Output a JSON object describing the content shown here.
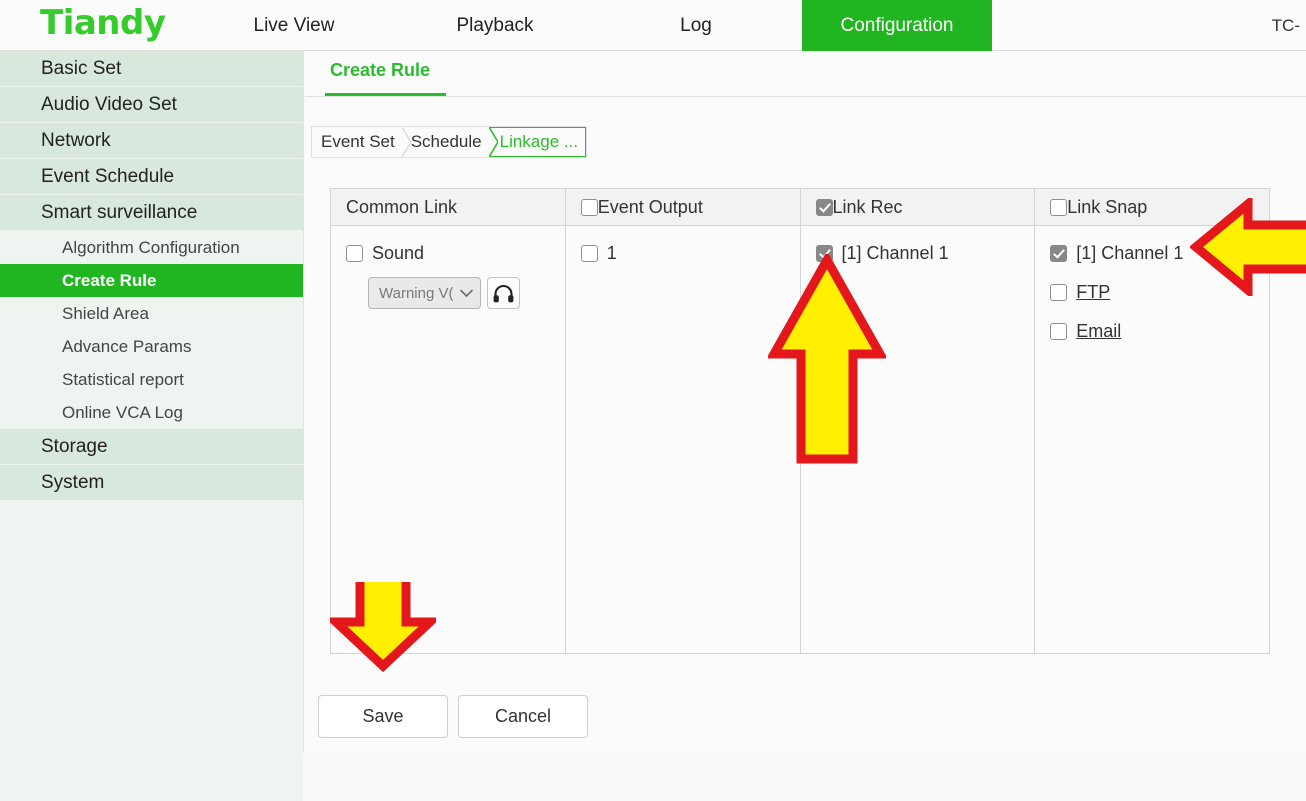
{
  "header": {
    "brand": "Tiandy",
    "nav": [
      {
        "id": "live-view",
        "label": "Live View",
        "active": false
      },
      {
        "id": "playback",
        "label": "Playback",
        "active": false
      },
      {
        "id": "log",
        "label": "Log",
        "active": false
      },
      {
        "id": "configuration",
        "label": "Configuration",
        "active": true
      }
    ],
    "device_model": "TC-",
    "active_color": "#22b522",
    "brand_color": "#35cc2c"
  },
  "sidebar": {
    "items": [
      {
        "label": "Basic Set",
        "level": "group",
        "active": false
      },
      {
        "label": "Audio Video Set",
        "level": "group",
        "active": false
      },
      {
        "label": "Network",
        "level": "group",
        "active": false
      },
      {
        "label": "Event Schedule",
        "level": "group",
        "active": false
      },
      {
        "label": "Smart surveillance",
        "level": "group",
        "active": false
      },
      {
        "label": "Algorithm Configuration",
        "level": "sub",
        "active": false
      },
      {
        "label": "Create Rule",
        "level": "sub",
        "active": true
      },
      {
        "label": "Shield Area",
        "level": "sub",
        "active": false
      },
      {
        "label": "Advance Params",
        "level": "sub",
        "active": false
      },
      {
        "label": "Statistical report",
        "level": "sub",
        "active": false
      },
      {
        "label": "Online VCA Log",
        "level": "sub",
        "active": false
      },
      {
        "label": "Storage",
        "level": "group",
        "active": false
      },
      {
        "label": "System",
        "level": "group",
        "active": false
      }
    ]
  },
  "content": {
    "tab_label": "Create Rule",
    "steps": [
      {
        "label": "Event Set",
        "active": false
      },
      {
        "label": "Schedule",
        "active": false
      },
      {
        "label": "Linkage ...",
        "active": true
      }
    ],
    "columns": [
      {
        "header": "Common Link",
        "header_has_checkbox": false,
        "header_checked": false,
        "rows": [
          {
            "label": "Sound",
            "checked": false,
            "link": false
          }
        ],
        "sound_select_value": "Warning V(",
        "audition_icon": "headphones-icon"
      },
      {
        "header": "Event Output",
        "header_has_checkbox": true,
        "header_checked": false,
        "rows": [
          {
            "label": "1",
            "checked": false,
            "link": false
          }
        ]
      },
      {
        "header": "Link Rec",
        "header_has_checkbox": true,
        "header_checked": true,
        "rows": [
          {
            "label": "[1] Channel 1",
            "checked": true,
            "link": false
          }
        ]
      },
      {
        "header": "Link Snap",
        "header_has_checkbox": true,
        "header_checked": false,
        "rows": [
          {
            "label": "[1] Channel 1",
            "checked": true,
            "link": false
          },
          {
            "label": "FTP",
            "checked": false,
            "link": true
          },
          {
            "label": "Email",
            "checked": false,
            "link": true
          }
        ]
      }
    ],
    "save_label": "Save",
    "cancel_label": "Cancel"
  },
  "annotations": {
    "fill": "#ffef00",
    "stroke": "#e4171c",
    "arrows": [
      {
        "name": "arrow-up-linkrec",
        "direction": "up",
        "points_at": "Link Rec channel checkbox"
      },
      {
        "name": "arrow-left-linksnap",
        "direction": "left",
        "points_at": "Link Snap channel checkbox"
      },
      {
        "name": "arrow-down-save",
        "direction": "down",
        "points_at": "Save button"
      }
    ]
  }
}
